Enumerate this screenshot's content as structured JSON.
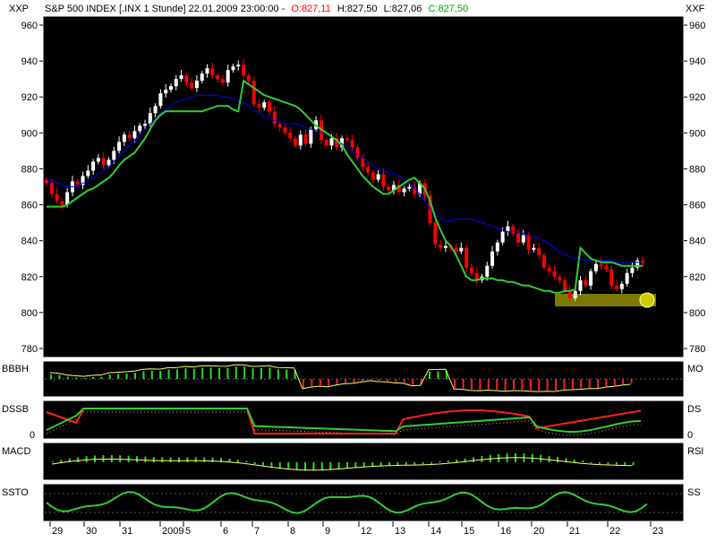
{
  "header": {
    "left_corner": "XXP",
    "right_corner": "XXF",
    "title": "S&P 500 INDEX [.INX  1 Stunde] 22.01.2009 23:00:00 -",
    "open": "O:827,11",
    "high": "H:827,50",
    "low": "L:827,06",
    "close": "C:827,50"
  },
  "colors": {
    "background": "#000000",
    "frame": "#ffffff",
    "up_candle": "#ffffff",
    "down_candle": "#ff0000",
    "blue_ma": "#0000ff",
    "green_line": "#33cc33",
    "yellow_line": "#ffff66",
    "histogram_up": "#22dd22",
    "histogram_down": "#ff2020",
    "highlight_box": "#7a7a00",
    "open_color": "#ff0000",
    "close_color": "#00a000"
  },
  "panels": {
    "p1": {
      "left": "BBBH",
      "right": "MO"
    },
    "p2": {
      "left": "DSSB",
      "right": "DS",
      "zero_left": "0",
      "zero_right": "0"
    },
    "p3": {
      "left": "MACD",
      "right": "RSI"
    },
    "p4": {
      "left": "SSTO",
      "right": "SS"
    }
  },
  "chart_data": {
    "type": "candlestick",
    "title": "S&P 500 INDEX [.INX  1 Stunde] 22.01.2009 23:00:00",
    "ylim": [
      775,
      965
    ],
    "y_ticks": [
      780,
      800,
      820,
      840,
      860,
      880,
      900,
      920,
      940,
      960
    ],
    "x_tick_labels": [
      "29",
      "30",
      "31",
      "2009",
      "5",
      "6",
      "7",
      "8",
      "9",
      "12",
      "13",
      "14",
      "15",
      "16",
      "20",
      "21",
      "22",
      "23"
    ],
    "series": [
      {
        "type": "candlestick",
        "closes": [
          872,
          866,
          862,
          860,
          867,
          873,
          871,
          876,
          879,
          884,
          886,
          882,
          885,
          890,
          895,
          899,
          897,
          901,
          904,
          905,
          911,
          915,
          922,
          924,
          926,
          930,
          932,
          928,
          925,
          929,
          933,
          936,
          932,
          930,
          928,
          935,
          937,
          938,
          932,
          929,
          916,
          914,
          917,
          912,
          905,
          903,
          900,
          897,
          893,
          899,
          894,
          902,
          907,
          896,
          893,
          897,
          892,
          897,
          896,
          892,
          886,
          881,
          878,
          874,
          877,
          870,
          868,
          871,
          867,
          869,
          870,
          866,
          872,
          865,
          850,
          838,
          836,
          837,
          836,
          834,
          836,
          825,
          822,
          818,
          820,
          826,
          834,
          839,
          845,
          848,
          844,
          839,
          843,
          835,
          836,
          832,
          825,
          823,
          820,
          818,
          812,
          808,
          812,
          818,
          815,
          823,
          827,
          826,
          824,
          815,
          813,
          816,
          822,
          825,
          829,
          827.5
        ]
      },
      {
        "name": "",
        "type": "line",
        "color": "blue",
        "values": [
          874,
          873,
          872,
          871,
          870,
          870,
          871,
          872,
          873,
          875,
          877,
          879,
          881,
          884,
          887,
          890,
          893,
          896,
          899,
          902,
          905,
          908,
          911,
          913,
          915,
          917,
          918,
          919,
          920,
          921,
          921,
          921,
          921,
          921,
          920,
          920,
          919,
          918,
          917,
          915,
          913,
          911,
          909,
          908,
          907,
          906,
          905,
          905,
          905,
          904,
          903,
          902,
          901,
          900,
          899,
          898,
          896,
          894,
          892,
          890,
          888,
          886,
          884,
          882,
          880,
          879,
          878,
          877,
          876,
          874,
          872,
          869,
          866,
          862,
          858,
          855,
          852,
          851,
          851,
          852,
          852,
          852,
          852,
          851,
          850,
          849,
          848,
          847,
          846,
          845,
          845,
          845,
          844,
          843,
          842,
          841,
          840,
          838,
          836,
          834,
          832,
          831,
          830,
          830,
          829,
          829,
          829,
          829,
          829,
          829,
          828,
          828,
          828,
          828,
          828,
          828
        ]
      },
      {
        "name": "",
        "type": "line",
        "color": "green",
        "values": [
          859,
          859,
          859,
          859,
          860,
          862,
          864,
          866,
          868,
          869,
          871,
          873,
          875,
          878,
          882,
          885,
          887,
          889,
          893,
          897,
          902,
          907,
          910,
          912,
          912,
          912,
          912,
          912,
          912,
          912,
          912,
          913,
          914,
          915,
          915,
          915,
          913,
          912,
          929,
          927,
          925,
          923,
          921,
          920,
          919,
          918,
          917,
          916,
          915,
          913,
          910,
          907,
          904,
          902,
          900,
          898,
          896,
          893,
          888,
          884,
          880,
          876,
          873,
          870,
          868,
          866,
          866,
          868,
          870,
          872,
          874,
          875,
          872,
          869,
          862,
          853,
          846,
          840,
          837,
          832,
          826,
          820,
          818,
          818,
          819,
          819,
          819,
          818,
          818,
          817,
          817,
          816,
          815,
          815,
          814,
          813,
          812,
          812,
          811,
          811,
          812,
          812,
          813,
          836,
          833,
          830,
          829,
          828,
          828,
          828,
          827,
          826,
          826,
          826,
          826,
          826
        ]
      }
    ]
  }
}
